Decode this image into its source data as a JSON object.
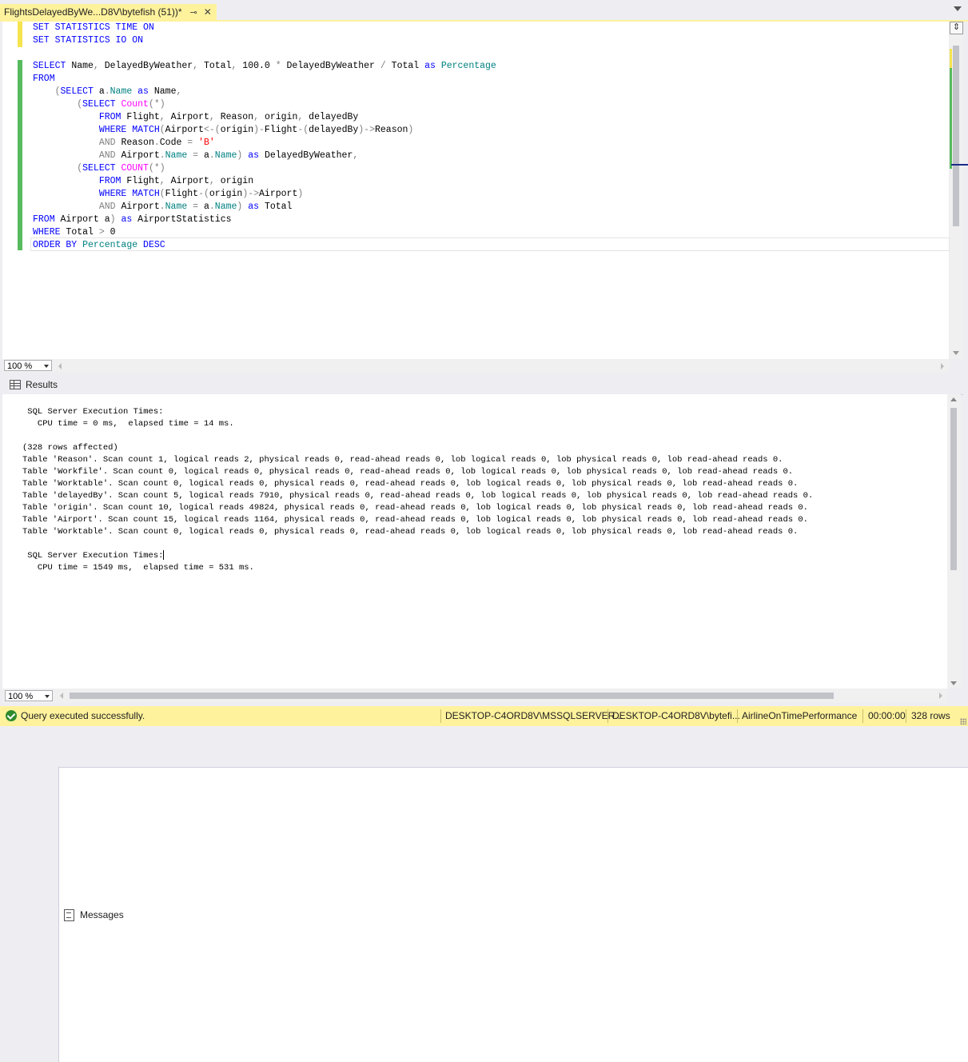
{
  "tab": {
    "title": "FlightsDelayedByWe...D8V\\bytefish (51))*",
    "pin_icon": "pin-icon",
    "close_icon": "close-icon"
  },
  "editor": {
    "lines": [
      [
        [
          "kw",
          "SET STATISTICS TIME ON"
        ]
      ],
      [
        [
          "kw",
          "SET STATISTICS IO ON"
        ]
      ],
      [],
      [
        [
          "kw",
          "SELECT "
        ],
        [
          "",
          "Name"
        ],
        [
          "gr",
          ", "
        ],
        [
          "",
          "DelayedByWeather"
        ],
        [
          "gr",
          ", "
        ],
        [
          "",
          "Total"
        ],
        [
          "gr",
          ", "
        ],
        [
          "",
          "100.0 "
        ],
        [
          "gr",
          "* "
        ],
        [
          "",
          "DelayedByWeather "
        ],
        [
          "gr",
          "/ "
        ],
        [
          "",
          "Total "
        ],
        [
          "kw",
          "as "
        ],
        [
          "id",
          "Percentage"
        ]
      ],
      [
        [
          "kw",
          "FROM"
        ]
      ],
      [
        [
          "",
          "    "
        ],
        [
          "gr",
          "("
        ],
        [
          "kw",
          "SELECT "
        ],
        [
          "",
          "a"
        ],
        [
          "gr",
          "."
        ],
        [
          "id",
          "Name "
        ],
        [
          "kw",
          "as "
        ],
        [
          "",
          "Name"
        ],
        [
          "gr",
          ","
        ]
      ],
      [
        [
          "",
          "        "
        ],
        [
          "gr",
          "("
        ],
        [
          "kw",
          "SELECT "
        ],
        [
          "fn",
          "Count"
        ],
        [
          "gr",
          "(*)"
        ]
      ],
      [
        [
          "",
          "            "
        ],
        [
          "kw",
          "FROM "
        ],
        [
          "",
          "Flight"
        ],
        [
          "gr",
          ", "
        ],
        [
          "",
          "Airport"
        ],
        [
          "gr",
          ", "
        ],
        [
          "",
          "Reason"
        ],
        [
          "gr",
          ", "
        ],
        [
          "",
          "origin"
        ],
        [
          "gr",
          ", "
        ],
        [
          "",
          "delayedBy"
        ]
      ],
      [
        [
          "",
          "            "
        ],
        [
          "kw",
          "WHERE MATCH"
        ],
        [
          "gr",
          "("
        ],
        [
          "",
          "Airport"
        ],
        [
          "gr",
          "<-("
        ],
        [
          "",
          "origin"
        ],
        [
          "gr",
          ")-"
        ],
        [
          "",
          "Flight"
        ],
        [
          "gr",
          "-("
        ],
        [
          "",
          "delayedBy"
        ],
        [
          "gr",
          ")->"
        ],
        [
          "",
          "Reason"
        ],
        [
          "gr",
          ")"
        ]
      ],
      [
        [
          "",
          "            "
        ],
        [
          "gr",
          "AND "
        ],
        [
          "",
          "Reason"
        ],
        [
          "gr",
          "."
        ],
        [
          "",
          "Code "
        ],
        [
          "gr",
          "= "
        ],
        [
          "str",
          "'B'"
        ]
      ],
      [
        [
          "",
          "            "
        ],
        [
          "gr",
          "AND "
        ],
        [
          "",
          "Airport"
        ],
        [
          "gr",
          "."
        ],
        [
          "id",
          "Name "
        ],
        [
          "gr",
          "= "
        ],
        [
          "",
          "a"
        ],
        [
          "gr",
          "."
        ],
        [
          "id",
          "Name"
        ],
        [
          "gr",
          ") "
        ],
        [
          "kw",
          "as "
        ],
        [
          "",
          "DelayedByWeather"
        ],
        [
          "gr",
          ","
        ]
      ],
      [
        [
          "",
          "        "
        ],
        [
          "gr",
          "("
        ],
        [
          "kw",
          "SELECT "
        ],
        [
          "fn",
          "COUNT"
        ],
        [
          "gr",
          "(*)"
        ]
      ],
      [
        [
          "",
          "            "
        ],
        [
          "kw",
          "FROM "
        ],
        [
          "",
          "Flight"
        ],
        [
          "gr",
          ", "
        ],
        [
          "",
          "Airport"
        ],
        [
          "gr",
          ", "
        ],
        [
          "",
          "origin"
        ]
      ],
      [
        [
          "",
          "            "
        ],
        [
          "kw",
          "WHERE MATCH"
        ],
        [
          "gr",
          "("
        ],
        [
          "",
          "Flight"
        ],
        [
          "gr",
          "-("
        ],
        [
          "",
          "origin"
        ],
        [
          "gr",
          ")->"
        ],
        [
          "",
          "Airport"
        ],
        [
          "gr",
          ")"
        ]
      ],
      [
        [
          "",
          "            "
        ],
        [
          "gr",
          "AND "
        ],
        [
          "",
          "Airport"
        ],
        [
          "gr",
          "."
        ],
        [
          "id",
          "Name "
        ],
        [
          "gr",
          "= "
        ],
        [
          "",
          "a"
        ],
        [
          "gr",
          "."
        ],
        [
          "id",
          "Name"
        ],
        [
          "gr",
          ") "
        ],
        [
          "kw",
          "as "
        ],
        [
          "",
          "Total"
        ]
      ],
      [
        [
          "kw",
          "FROM "
        ],
        [
          "",
          "Airport a"
        ],
        [
          "gr",
          ") "
        ],
        [
          "kw",
          "as "
        ],
        [
          "",
          "AirportStatistics"
        ]
      ],
      [
        [
          "kw",
          "WHERE "
        ],
        [
          "",
          "Total "
        ],
        [
          "gr",
          "> "
        ],
        [
          "",
          "0"
        ]
      ],
      [
        [
          "kw",
          "ORDER BY "
        ],
        [
          "id",
          "Percentage "
        ],
        [
          "kw",
          "DESC"
        ]
      ]
    ],
    "zoom": "100 %"
  },
  "results_tabs": {
    "results_label": "Results",
    "messages_label": "Messages"
  },
  "messages": {
    "lines": [
      " SQL Server Execution Times:",
      "   CPU time = 0 ms,  elapsed time = 14 ms.",
      "",
      "(328 rows affected)",
      "Table 'Reason'. Scan count 1, logical reads 2, physical reads 0, read-ahead reads 0, lob logical reads 0, lob physical reads 0, lob read-ahead reads 0.",
      "Table 'Workfile'. Scan count 0, logical reads 0, physical reads 0, read-ahead reads 0, lob logical reads 0, lob physical reads 0, lob read-ahead reads 0.",
      "Table 'Worktable'. Scan count 0, logical reads 0, physical reads 0, read-ahead reads 0, lob logical reads 0, lob physical reads 0, lob read-ahead reads 0.",
      "Table 'delayedBy'. Scan count 5, logical reads 7910, physical reads 0, read-ahead reads 0, lob logical reads 0, lob physical reads 0, lob read-ahead reads 0.",
      "Table 'origin'. Scan count 10, logical reads 49824, physical reads 0, read-ahead reads 0, lob logical reads 0, lob physical reads 0, lob read-ahead reads 0.",
      "Table 'Airport'. Scan count 15, logical reads 1164, physical reads 0, read-ahead reads 0, lob logical reads 0, lob physical reads 0, lob read-ahead reads 0.",
      "Table 'Worktable'. Scan count 0, logical reads 0, physical reads 0, read-ahead reads 0, lob logical reads 0, lob physical reads 0, lob read-ahead reads 0.",
      "",
      " SQL Server Execution Times:",
      "   CPU time = 1549 ms,  elapsed time = 531 ms."
    ],
    "zoom": "100 %"
  },
  "statusbar": {
    "message": "Query executed successfully.",
    "server": "DESKTOP-C4ORD8V\\MSSQLSERVER...",
    "user": "DESKTOP-C4ORD8V\\bytefi...",
    "database": "AirlineOnTimePerformance",
    "elapsed": "00:00:00",
    "rows": "328 rows"
  },
  "colors": {
    "accent": "#FFF29D",
    "keyword": "#0000FF",
    "function": "#FF00FF",
    "string": "#FF0000",
    "operator": "#808080",
    "identifier": "#008080",
    "success": "#2E8B2E"
  }
}
